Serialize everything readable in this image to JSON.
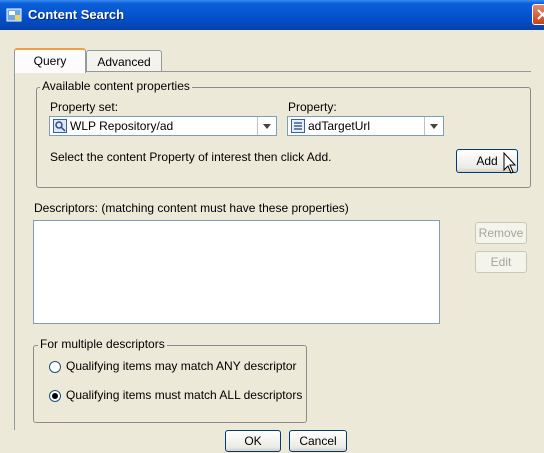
{
  "window": {
    "title": "Content Search"
  },
  "tabs": [
    {
      "label": "Query",
      "active": true
    },
    {
      "label": "Advanced",
      "mnemonic": "v",
      "active": false
    }
  ],
  "available_group": {
    "legend": "Available content properties",
    "property_set_label": "Property set:",
    "property_set_value": "WLP Repository/ad",
    "property_label": "Property:",
    "property_value": "adTargetUrl",
    "instruction": "Select the content Property of interest then click Add.",
    "add_button": "Add"
  },
  "descriptors": {
    "label": "Descriptors:  (matching content must have these properties)",
    "remove_button": "Remove",
    "edit_button": "Edit"
  },
  "multiple_group": {
    "legend": "For multiple descriptors",
    "option_any": "Qualifying items may match ANY descriptor",
    "option_all": "Qualifying items must match ALL descriptors",
    "selected": "all"
  },
  "footer": {
    "ok_button": "OK",
    "cancel_button": "Cancel"
  }
}
